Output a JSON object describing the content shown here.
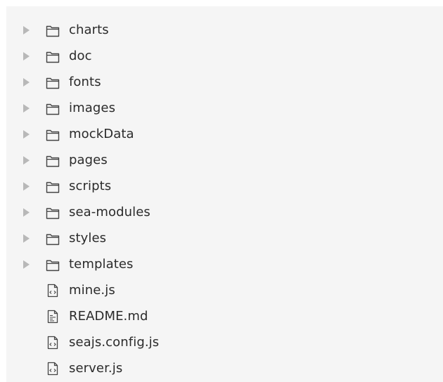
{
  "tree": {
    "folders": [
      {
        "label": "charts",
        "icon": "folder-icon",
        "expander": "collapsed-arrow-icon"
      },
      {
        "label": "doc",
        "icon": "folder-icon",
        "expander": "collapsed-arrow-icon"
      },
      {
        "label": "fonts",
        "icon": "folder-icon",
        "expander": "collapsed-arrow-icon"
      },
      {
        "label": "images",
        "icon": "folder-icon",
        "expander": "collapsed-arrow-icon"
      },
      {
        "label": "mockData",
        "icon": "folder-icon",
        "expander": "collapsed-arrow-icon"
      },
      {
        "label": "pages",
        "icon": "folder-icon",
        "expander": "collapsed-arrow-icon"
      },
      {
        "label": "scripts",
        "icon": "folder-icon",
        "expander": "collapsed-arrow-icon"
      },
      {
        "label": "sea-modules",
        "icon": "folder-icon",
        "expander": "collapsed-arrow-icon"
      },
      {
        "label": "styles",
        "icon": "folder-icon",
        "expander": "collapsed-arrow-icon"
      },
      {
        "label": "templates",
        "icon": "folder-icon",
        "expander": "collapsed-arrow-icon"
      }
    ],
    "files": [
      {
        "label": "mine.js",
        "icon": "code-file-icon"
      },
      {
        "label": "README.md",
        "icon": "text-file-icon"
      },
      {
        "label": "seajs.config.js",
        "icon": "code-file-icon"
      },
      {
        "label": "server.js",
        "icon": "code-file-icon"
      }
    ]
  },
  "colors": {
    "background": "#f5f5f5",
    "text": "#2b2b2b",
    "arrow": "#b8b8b8",
    "icon": "#444444"
  }
}
